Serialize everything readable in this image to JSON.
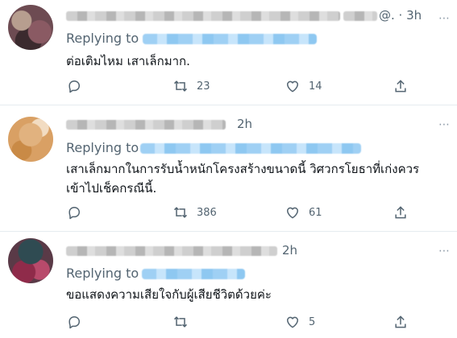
{
  "tweets": [
    {
      "time_suffix": "@. · 3h",
      "replying_prefix": "Replying to",
      "text": "ต่อเติมไหม เสาเล็กมาก.",
      "retweets": "23",
      "likes": "14"
    },
    {
      "time": "2h",
      "replying_prefix": "Replying to",
      "text": "เสาเล็กมากในการรับน้ำหนักโครงสร้างขนาดนี้ วิศวกรโยธาที่เก่งควรเข้าไปเช็คกรณีนี้.",
      "retweets": "386",
      "likes": "61"
    },
    {
      "time": "2h",
      "replying_prefix": "Replying to",
      "text": "ขอแสดงความเสียใจกับผู้เสียชีวิตด้วยค่ะ",
      "retweets": "",
      "likes": "5"
    }
  ],
  "icons": {
    "reply": "reply-icon",
    "retweet": "retweet-icon",
    "like": "like-icon",
    "share": "share-icon",
    "more": "more-icon"
  },
  "colors": {
    "text": "#0f1419",
    "muted": "#536471",
    "divider": "#e6ecf0",
    "link_blur": "#9fd0f4"
  }
}
